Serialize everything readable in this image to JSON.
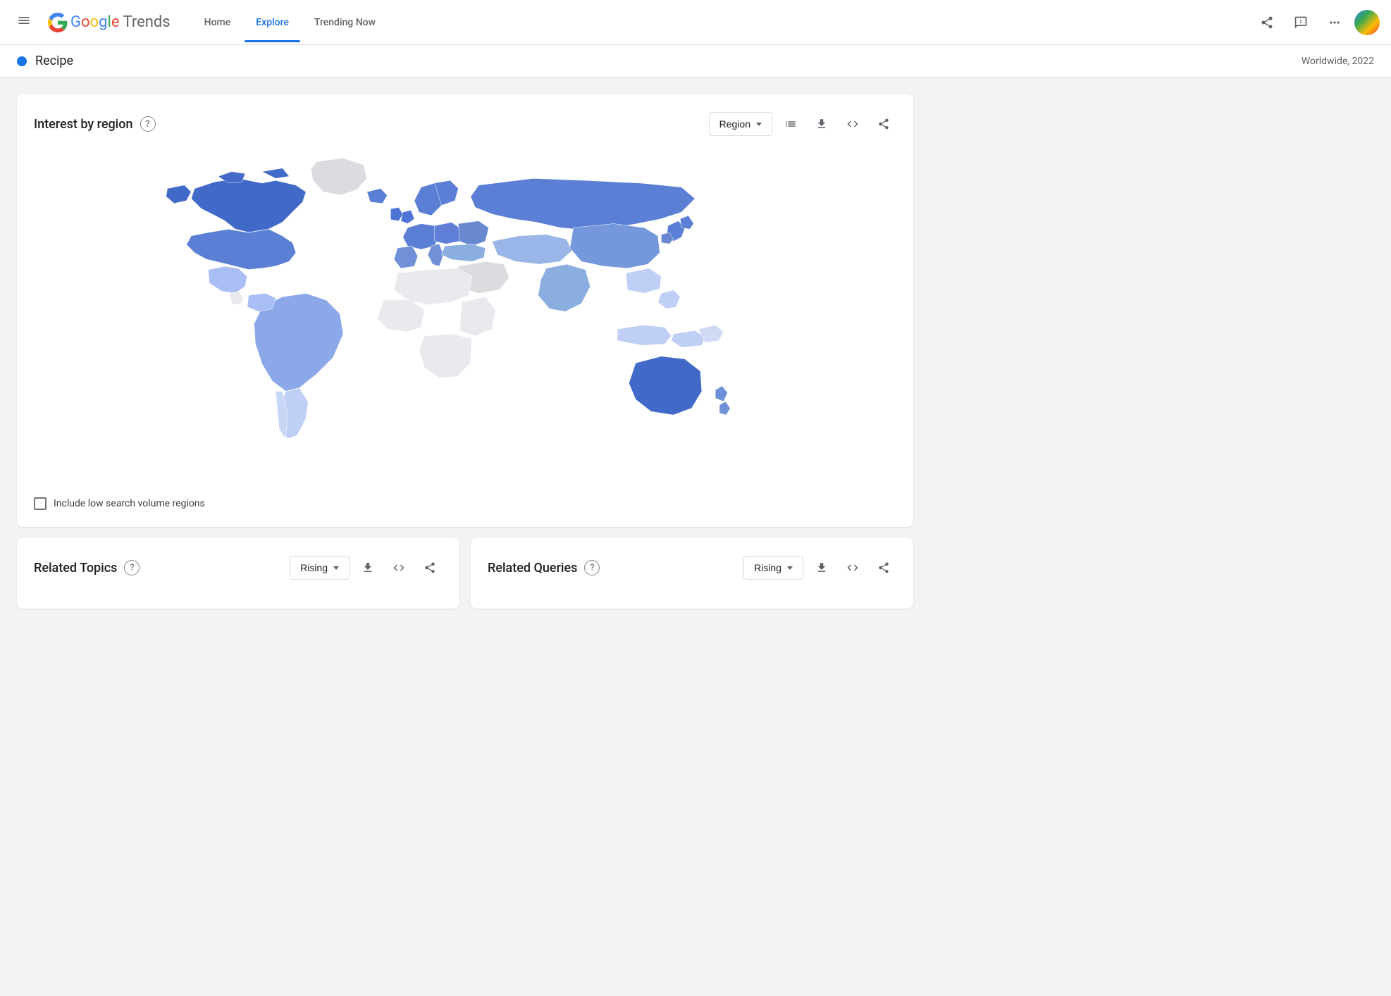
{
  "header": {
    "menu_label": "Menu",
    "logo": {
      "google": "Google",
      "trends": "Trends"
    },
    "nav": [
      {
        "id": "home",
        "label": "Home",
        "active": false
      },
      {
        "id": "explore",
        "label": "Explore",
        "active": true
      },
      {
        "id": "trending",
        "label": "Trending Now",
        "active": false
      }
    ],
    "icons": {
      "share": "share",
      "feedback": "feedback",
      "apps": "apps"
    }
  },
  "search_bar": {
    "term": "Recipe",
    "location_time": "Worldwide, 2022"
  },
  "interest_by_region": {
    "title": "Interest by region",
    "help": "?",
    "region_button_label": "Region",
    "actions": {
      "list": "List view",
      "download": "Download",
      "embed": "Embed",
      "share": "Share"
    },
    "checkbox_label": "Include low search volume regions"
  },
  "related_topics": {
    "title": "Related Topics",
    "help": "?",
    "filter_label": "Rising",
    "actions": {
      "download": "Download",
      "embed": "Embed",
      "share": "Share"
    }
  },
  "related_queries": {
    "title": "Related Queries",
    "help": "?",
    "filter_label": "Rising",
    "actions": {
      "download": "Download",
      "embed": "Embed",
      "share": "Share"
    }
  }
}
